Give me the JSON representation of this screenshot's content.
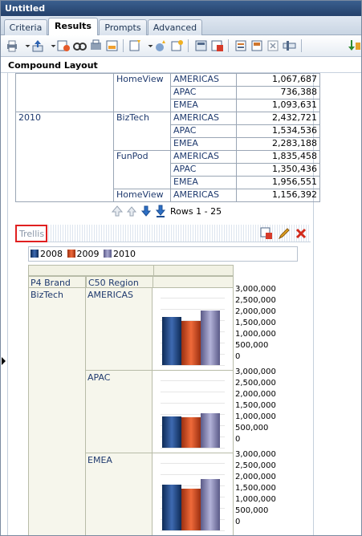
{
  "window": {
    "title": "Untitled"
  },
  "tabs": [
    {
      "label": "Criteria",
      "active": false
    },
    {
      "label": "Results",
      "active": true
    },
    {
      "label": "Prompts",
      "active": false
    },
    {
      "label": "Advanced",
      "active": false
    }
  ],
  "section": {
    "title": "Compound Layout"
  },
  "table": {
    "rows": [
      {
        "year": "",
        "brand": "HomeView",
        "region": "AMERICAS",
        "value": "1,067,687"
      },
      {
        "year": "",
        "brand": "",
        "region": "APAC",
        "value": "736,388"
      },
      {
        "year": "",
        "brand": "",
        "region": "EMEA",
        "value": "1,093,631"
      },
      {
        "year": "2010",
        "brand": "BizTech",
        "region": "AMERICAS",
        "value": "2,432,721"
      },
      {
        "year": "",
        "brand": "",
        "region": "APAC",
        "value": "1,534,536"
      },
      {
        "year": "",
        "brand": "",
        "region": "EMEA",
        "value": "2,283,188"
      },
      {
        "year": "",
        "brand": "FunPod",
        "region": "AMERICAS",
        "value": "1,835,458"
      },
      {
        "year": "",
        "brand": "",
        "region": "APAC",
        "value": "1,350,436"
      },
      {
        "year": "",
        "brand": "",
        "region": "EMEA",
        "value": "1,956,551"
      },
      {
        "year": "",
        "brand": "HomeView",
        "region": "AMERICAS",
        "value": "1,156,392"
      }
    ]
  },
  "pager": {
    "rows_text": "Rows 1 - 25"
  },
  "trellis": {
    "label": "Trellis",
    "legend": [
      {
        "name": "2008",
        "color": "#1e3f73"
      },
      {
        "name": "2009",
        "color": "#d14a1e"
      },
      {
        "name": "2010",
        "color": "#7a79a8"
      }
    ],
    "headers": {
      "brand": "P4 Brand",
      "region": "C50 Region"
    },
    "brand": "BizTech",
    "axis_ticks": [
      "3,000,000",
      "2,500,000",
      "2,000,000",
      "1,500,000",
      "1,000,000",
      "500,000",
      "0"
    ],
    "panels": [
      {
        "region": "AMERICAS"
      },
      {
        "region": "APAC"
      },
      {
        "region": "EMEA"
      }
    ]
  },
  "chart_data": [
    {
      "type": "bar",
      "title": "",
      "categories": [
        "AMERICAS"
      ],
      "ylim": [
        0,
        3000000
      ],
      "series": [
        {
          "name": "2008",
          "values": [
            2150000
          ]
        },
        {
          "name": "2009",
          "values": [
            1950000
          ]
        },
        {
          "name": "2010",
          "values": [
            2432721
          ]
        }
      ]
    },
    {
      "type": "bar",
      "title": "",
      "categories": [
        "APAC"
      ],
      "ylim": [
        0,
        3000000
      ],
      "series": [
        {
          "name": "2008",
          "values": [
            1400000
          ]
        },
        {
          "name": "2009",
          "values": [
            1350000
          ]
        },
        {
          "name": "2010",
          "values": [
            1534536
          ]
        }
      ]
    },
    {
      "type": "bar",
      "title": "",
      "categories": [
        "EMEA"
      ],
      "ylim": [
        0,
        3000000
      ],
      "series": [
        {
          "name": "2008",
          "values": [
            2050000
          ]
        },
        {
          "name": "2009",
          "values": [
            1850000
          ]
        },
        {
          "name": "2010",
          "values": [
            2283188
          ]
        }
      ]
    }
  ]
}
